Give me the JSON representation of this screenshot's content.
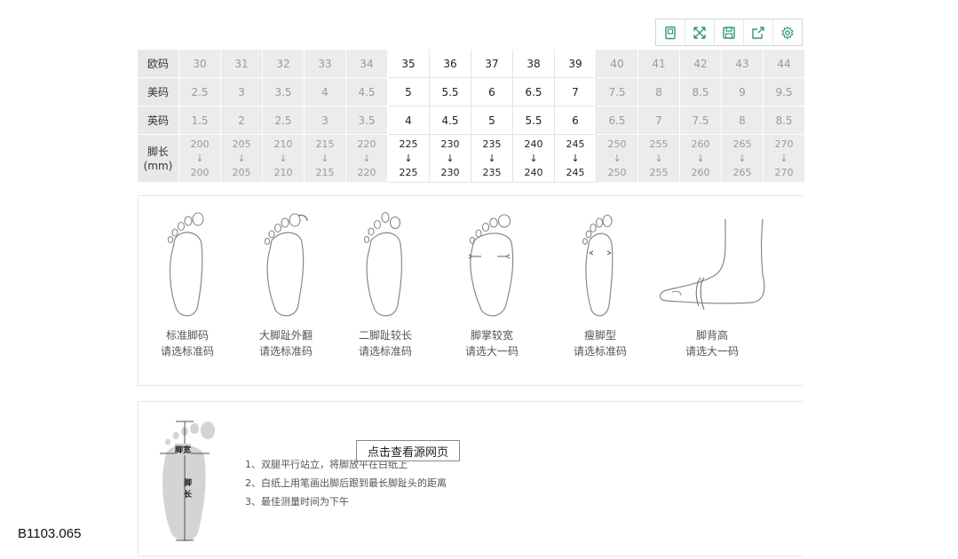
{
  "toolbar": {
    "icons": [
      "bookmark-icon",
      "expand-icon",
      "save-icon",
      "share-icon",
      "settings-icon"
    ],
    "accent": "#2e9c6a"
  },
  "size_table": {
    "rows": [
      {
        "label": "欧码",
        "values": [
          "30",
          "31",
          "32",
          "33",
          "34",
          "35",
          "36",
          "37",
          "38",
          "39",
          "40",
          "41",
          "42",
          "43",
          "44"
        ]
      },
      {
        "label": "美码",
        "values": [
          "2.5",
          "3",
          "3.5",
          "4",
          "4.5",
          "5",
          "5.5",
          "6",
          "6.5",
          "7",
          "7.5",
          "8",
          "8.5",
          "9",
          "9.5"
        ]
      },
      {
        "label": "英码",
        "values": [
          "1.5",
          "2",
          "2.5",
          "3",
          "3.5",
          "4",
          "4.5",
          "5",
          "5.5",
          "6",
          "6.5",
          "7",
          "7.5",
          "8",
          "8.5"
        ]
      }
    ],
    "length_label": "脚长",
    "length_unit": "(mm)",
    "arrow": "↓",
    "lengths_from": [
      "200",
      "205",
      "210",
      "215",
      "220",
      "225",
      "230",
      "235",
      "240",
      "245",
      "250",
      "255",
      "260",
      "265",
      "270"
    ],
    "lengths_to": [
      "200",
      "205",
      "210",
      "215",
      "220",
      "225",
      "230",
      "235",
      "240",
      "245",
      "250",
      "255",
      "260",
      "265",
      "270"
    ]
  },
  "foot_types": [
    {
      "name": "标准脚码",
      "advice": "请选标准码"
    },
    {
      "name": "大脚趾外翻",
      "advice": "请选标准码"
    },
    {
      "name": "二脚趾较长",
      "advice": "请选标准码"
    },
    {
      "name": "脚掌较宽",
      "advice": "请选大一码"
    },
    {
      "name": "瘦脚型",
      "advice": "请选标准码"
    },
    {
      "name": "脚背高",
      "advice": "请选大一码"
    }
  ],
  "measure": {
    "width_label": "脚宽",
    "length_label_1": "脚",
    "length_label_2": "长",
    "steps": [
      "1、双腿平行站立，将脚放平在白纸上",
      "2、白纸上用笔画出脚后跟到最长脚趾头的距离",
      "3、最佳测量时间为下午"
    ]
  },
  "overlay_button": "点击查看源网页",
  "product_code": "B1103.065"
}
